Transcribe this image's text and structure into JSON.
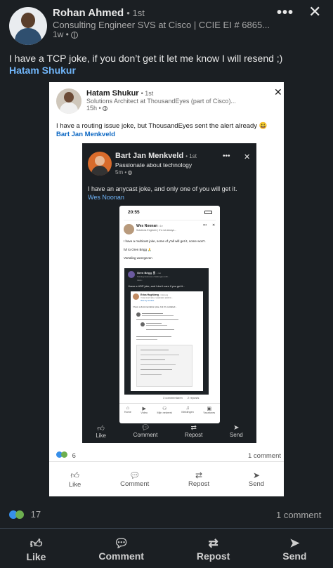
{
  "post": {
    "author": "Rohan Ahmed",
    "degree": "• 1st",
    "headline": "Consulting Engineer SVS at Cisco | CCIE EI # 6865...",
    "time": "1w •",
    "text": "I have a TCP joke, if you don’t get it let me know I will resend ;)",
    "mention": "Hatam Shukur",
    "reactions_count": "17",
    "comments_count": "1 comment",
    "actions": [
      "Like",
      "Comment",
      "Repost",
      "Send"
    ]
  },
  "level1": {
    "author": "Hatam Shukur",
    "degree": "• 1st",
    "headline": "Solutions Architect at ThousandEyes (part of Cisco)...",
    "time": "15h •",
    "text": "I have a routing issue joke, but ThousandEyes sent the alert already 😃",
    "mention": "Bart Jan Menkveld",
    "reactions_count": "6",
    "comments_count": "1 comment",
    "actions": [
      "Like",
      "Comment",
      "Repost",
      "Send"
    ]
  },
  "level2": {
    "author": "Bart Jan Menkveld",
    "degree": "• 1st",
    "headline": "Passionate about technology",
    "time": "5m •",
    "text": "I have an anycast joke, and only one of you will get it.",
    "mention": "Wes Noonan",
    "actions": [
      "Like",
      "Comment",
      "Repost",
      "Send"
    ]
  },
  "level3": {
    "status_time": "20:55",
    "author": "Wes Noonan",
    "degree": "• 1e",
    "headline": "Solutions Engineer | It's not always...",
    "text": "I have a multicast joke,  some of y'all will get it, some won't.",
    "hat_tip": "h/t to Oren Brigg 🙏",
    "translate": "Vertaling weergeven",
    "comments_count": "3 commentaren",
    "reposts_count": "2 reposts",
    "nav": [
      "Home",
      "Video",
      "Mijn netwerk",
      "Meldingen",
      "Vacatures"
    ]
  },
  "level4": {
    "author": "Oren Brigg 🎗",
    "degree": "• 1st",
    "headline": "Solving business challenges with...",
    "time": "now •",
    "text": "I have a UDP joke, and I don't care if you get it..."
  },
  "level5": {
    "author": "Erica Hughberg",
    "degree": "• Following",
    "headline": "I help cloud native / application platform...",
    "link": "View my services",
    "text": "I have a documentation joke, but it's outdated..."
  },
  "colors": {
    "background": "#1b1f23",
    "text": "#e8e8e8",
    "muted": "#a8a8a8",
    "link": "#70b5f9",
    "card": "#ffffff",
    "card_link": "#0a66c2"
  }
}
